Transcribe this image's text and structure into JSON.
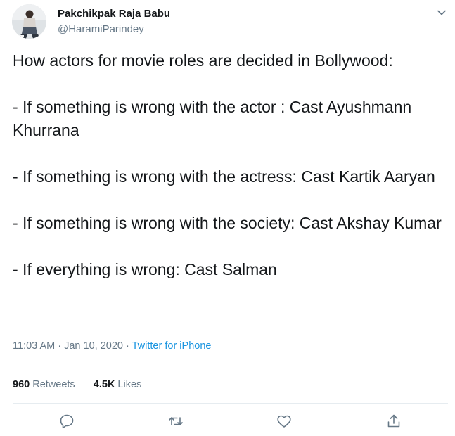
{
  "author": {
    "name": "Pakchikpak Raja Babu",
    "handle": "@HaramiParindey"
  },
  "tweet": {
    "lines": [
      "How actors for movie roles are decided in Bollywood:",
      "- If something is wrong with the actor : Cast Ayushmann Khurrana",
      "- If something is wrong with the actress: Cast Kartik Aaryan",
      "- If something is wrong with the society: Cast Akshay Kumar",
      "- If everything is wrong: Cast Salman"
    ]
  },
  "meta": {
    "time": "11:03 AM",
    "separator": "·",
    "date": "Jan 10, 2020",
    "source": "Twitter for iPhone"
  },
  "stats": {
    "retweets_count": "960",
    "retweets_label": "Retweets",
    "likes_count": "4.5K",
    "likes_label": "Likes"
  },
  "icons": {
    "caret": "chevron-down-icon",
    "reply": "reply-icon",
    "retweet": "retweet-icon",
    "like": "heart-icon",
    "share": "share-icon"
  },
  "colors": {
    "text": "#14171a",
    "secondary": "#657786",
    "link": "#1b95e0",
    "divider": "#e6ecf0"
  }
}
